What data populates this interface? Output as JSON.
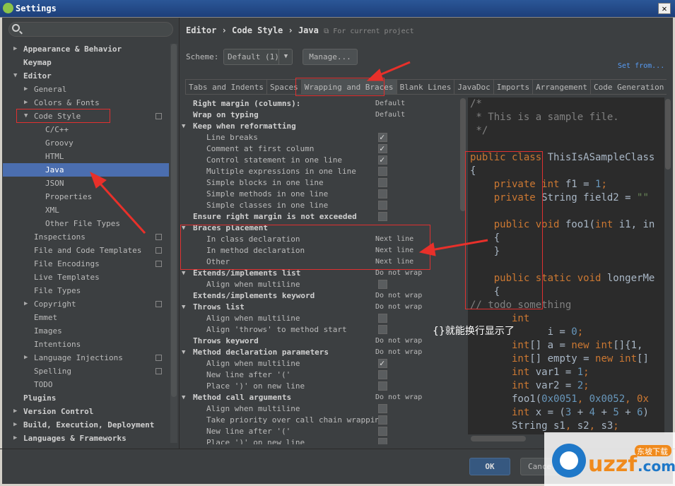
{
  "window": {
    "title": "Settings",
    "close": "✕"
  },
  "sidebar": {
    "items": [
      {
        "label": "Appearance & Behavior",
        "level": 0,
        "arrow": "right",
        "bold": true
      },
      {
        "label": "Keymap",
        "level": 0,
        "bold": true
      },
      {
        "label": "Editor",
        "level": 0,
        "arrow": "down",
        "bold": true
      },
      {
        "label": "General",
        "level": 1,
        "arrow": "right"
      },
      {
        "label": "Colors & Fonts",
        "level": 1,
        "arrow": "right"
      },
      {
        "label": "Code Style",
        "level": 1,
        "arrow": "down",
        "copy": true
      },
      {
        "label": "C/C++",
        "level": 2
      },
      {
        "label": "Groovy",
        "level": 2
      },
      {
        "label": "HTML",
        "level": 2
      },
      {
        "label": "Java",
        "level": 2,
        "selected": true
      },
      {
        "label": "JSON",
        "level": 2
      },
      {
        "label": "Properties",
        "level": 2
      },
      {
        "label": "XML",
        "level": 2
      },
      {
        "label": "Other File Types",
        "level": 2
      },
      {
        "label": "Inspections",
        "level": 1,
        "copy": true
      },
      {
        "label": "File and Code Templates",
        "level": 1,
        "copy": true
      },
      {
        "label": "File Encodings",
        "level": 1,
        "copy": true
      },
      {
        "label": "Live Templates",
        "level": 1
      },
      {
        "label": "File Types",
        "level": 1
      },
      {
        "label": "Copyright",
        "level": 1,
        "arrow": "right",
        "copy": true
      },
      {
        "label": "Emmet",
        "level": 1
      },
      {
        "label": "Images",
        "level": 1
      },
      {
        "label": "Intentions",
        "level": 1
      },
      {
        "label": "Language Injections",
        "level": 1,
        "arrow": "right",
        "copy": true
      },
      {
        "label": "Spelling",
        "level": 1,
        "copy": true
      },
      {
        "label": "TODO",
        "level": 1
      },
      {
        "label": "Plugins",
        "level": 0,
        "bold": true
      },
      {
        "label": "Version Control",
        "level": 0,
        "arrow": "right",
        "bold": true
      },
      {
        "label": "Build, Execution, Deployment",
        "level": 0,
        "arrow": "right",
        "bold": true
      },
      {
        "label": "Languages & Frameworks",
        "level": 0,
        "arrow": "right",
        "bold": true
      }
    ]
  },
  "breadcrumb": {
    "text": "Editor › Code Style › Java",
    "hint": "For current project"
  },
  "scheme": {
    "label": "Scheme:",
    "value": "Default (1)",
    "manage": "Manage...",
    "set_from": "Set from..."
  },
  "tabs": [
    "Tabs and Indents",
    "Spaces",
    "Wrapping and Braces",
    "Blank Lines",
    "JavaDoc",
    "Imports",
    "Arrangement",
    "Code Generation"
  ],
  "active_tab": "Wrapping and Braces",
  "settings": [
    {
      "label": "Right margin (columns):",
      "bold": true,
      "value": "Default"
    },
    {
      "label": "Wrap on typing",
      "bold": true,
      "value": "Default"
    },
    {
      "label": "Keep when reformatting",
      "bold": true,
      "group": true
    },
    {
      "label": "Line breaks",
      "checked": true
    },
    {
      "label": "Comment at first column",
      "checked": true
    },
    {
      "label": "Control statement in one line",
      "checked": true
    },
    {
      "label": "Multiple expressions in one line",
      "checked": false
    },
    {
      "label": "Simple blocks in one line",
      "checked": false
    },
    {
      "label": "Simple methods in one line",
      "checked": false
    },
    {
      "label": "Simple classes in one line",
      "checked": false
    },
    {
      "label": "Ensure right margin is not exceeded",
      "bold": true,
      "checked": false
    },
    {
      "label": "Braces placement",
      "bold": true,
      "group": true
    },
    {
      "label": "In class declaration",
      "value": "Next line"
    },
    {
      "label": "In method declaration",
      "value": "Next line"
    },
    {
      "label": "Other",
      "value": "Next line"
    },
    {
      "label": "Extends/implements list",
      "bold": true,
      "group": true,
      "value": "Do not wrap"
    },
    {
      "label": "Align when multiline",
      "checked": false
    },
    {
      "label": "Extends/implements keyword",
      "bold": true,
      "value": "Do not wrap"
    },
    {
      "label": "Throws list",
      "bold": true,
      "group": true,
      "value": "Do not wrap"
    },
    {
      "label": "Align when multiline",
      "checked": false
    },
    {
      "label": "Align 'throws' to method start",
      "checked": false
    },
    {
      "label": "Throws keyword",
      "bold": true,
      "value": "Do not wrap"
    },
    {
      "label": "Method declaration parameters",
      "bold": true,
      "group": true,
      "value": "Do not wrap"
    },
    {
      "label": "Align when multiline",
      "checked": true
    },
    {
      "label": "New line after '('",
      "checked": false
    },
    {
      "label": "Place ')' on new line",
      "checked": false
    },
    {
      "label": "Method call arguments",
      "bold": true,
      "group": true,
      "value": "Do not wrap"
    },
    {
      "label": "Align when multiline",
      "checked": false
    },
    {
      "label": "Take priority over call chain wrapping",
      "checked": false
    },
    {
      "label": "New line after '('",
      "checked": false
    },
    {
      "label": "Place ')' on new line",
      "checked": false
    }
  ],
  "code_lines": [
    [
      [
        "/*",
        "#808080"
      ]
    ],
    [
      [
        " * This is a sample file.",
        "#808080"
      ]
    ],
    [
      [
        " */",
        "#808080"
      ]
    ],
    [],
    [
      [
        "public class ",
        "#cc7832"
      ],
      [
        "ThisIsASampleClass",
        "#a9b7c6"
      ]
    ],
    [
      [
        "{",
        "#a9b7c6"
      ]
    ],
    [
      [
        "    private int ",
        "#cc7832"
      ],
      [
        "f1 = ",
        "#a9b7c6"
      ],
      [
        "1",
        "#6897bb"
      ],
      [
        ";",
        "#cc7832"
      ]
    ],
    [
      [
        "    private ",
        "#cc7832"
      ],
      [
        "String field2 = ",
        "#a9b7c6"
      ],
      [
        "\"\"",
        "#6a8759"
      ]
    ],
    [],
    [
      [
        "    public void ",
        "#cc7832"
      ],
      [
        "foo1(",
        "#a9b7c6"
      ],
      [
        "int ",
        "#cc7832"
      ],
      [
        "i1, in",
        "#a9b7c6"
      ]
    ],
    [
      [
        "    {",
        "#a9b7c6"
      ]
    ],
    [
      [
        "    }",
        "#a9b7c6"
      ]
    ],
    [],
    [
      [
        "    public static void ",
        "#cc7832"
      ],
      [
        "longerMe",
        "#a9b7c6"
      ]
    ],
    [
      [
        "    {",
        "#a9b7c6"
      ]
    ],
    [
      [
        "// todo something",
        "#808080"
      ]
    ],
    [
      [
        "       int",
        "#cc7832"
      ]
    ],
    [
      [
        "             i = ",
        "#a9b7c6"
      ],
      [
        "0",
        "#6897bb"
      ],
      [
        ";",
        "#cc7832"
      ]
    ],
    [
      [
        "       int",
        "#cc7832"
      ],
      [
        "[] a = ",
        "#a9b7c6"
      ],
      [
        "new int",
        "#cc7832"
      ],
      [
        "[]{1,",
        "#a9b7c6"
      ]
    ],
    [
      [
        "       int",
        "#cc7832"
      ],
      [
        "[] empty = ",
        "#a9b7c6"
      ],
      [
        "new int",
        "#cc7832"
      ],
      [
        "[]",
        "#a9b7c6"
      ]
    ],
    [
      [
        "       int ",
        "#cc7832"
      ],
      [
        "var1 = ",
        "#a9b7c6"
      ],
      [
        "1",
        "#6897bb"
      ],
      [
        ";",
        "#cc7832"
      ]
    ],
    [
      [
        "       int ",
        "#cc7832"
      ],
      [
        "var2 = ",
        "#a9b7c6"
      ],
      [
        "2",
        "#6897bb"
      ],
      [
        ";",
        "#cc7832"
      ]
    ],
    [
      [
        "       foo1(",
        "#a9b7c6"
      ],
      [
        "0x0051",
        "#6897bb"
      ],
      [
        ", ",
        "#cc7832"
      ],
      [
        "0x0052",
        "#6897bb"
      ],
      [
        ", 0x",
        "#cc7832"
      ]
    ],
    [
      [
        "       int ",
        "#cc7832"
      ],
      [
        "x = (",
        "#a9b7c6"
      ],
      [
        "3",
        "#6897bb"
      ],
      [
        " + ",
        "#a9b7c6"
      ],
      [
        "4",
        "#6897bb"
      ],
      [
        " + ",
        "#a9b7c6"
      ],
      [
        "5",
        "#6897bb"
      ],
      [
        " + ",
        "#a9b7c6"
      ],
      [
        "6",
        "#6897bb"
      ],
      [
        ")",
        "#a9b7c6"
      ]
    ],
    [
      [
        "       String s1",
        "#a9b7c6"
      ],
      [
        ", ",
        "#cc7832"
      ],
      [
        "s2",
        "#a9b7c6"
      ],
      [
        ", ",
        "#cc7832"
      ],
      [
        "s3",
        "#a9b7c6"
      ],
      [
        ";",
        "#cc7832"
      ]
    ]
  ],
  "annotation": {
    "note": "{}就能换行显示了",
    "color": "#e03030"
  },
  "buttons": {
    "ok": "OK",
    "cancel": "Cancel"
  },
  "watermark": {
    "text": "uzzf.com",
    "badge": "东坡下载"
  }
}
